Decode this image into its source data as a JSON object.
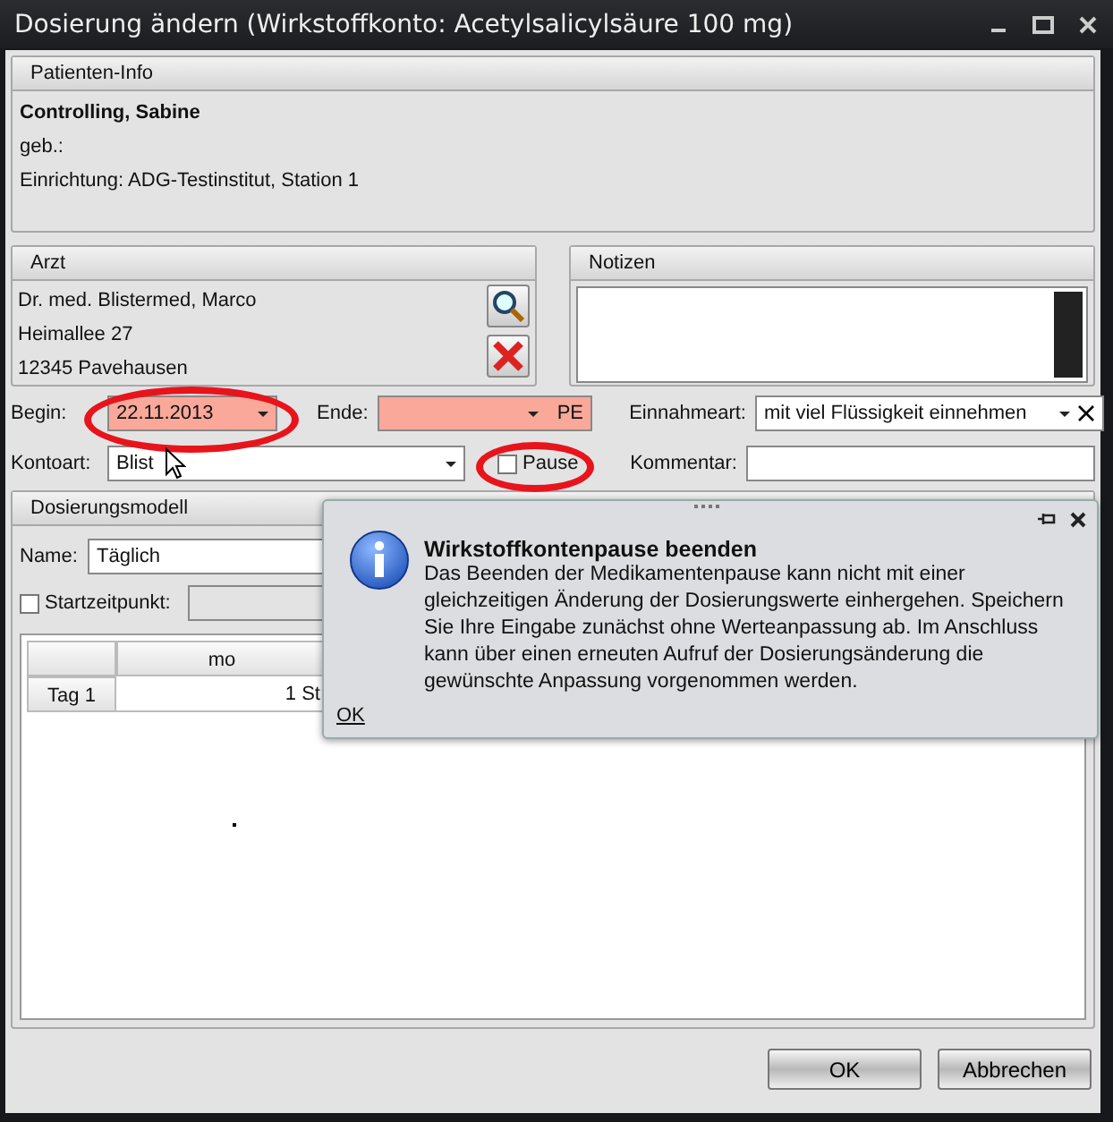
{
  "window": {
    "title": "Dosierung ändern (Wirkstoffkonto: Acetylsalicylsäure 100 mg)"
  },
  "patient_info": {
    "header": "Patienten-Info",
    "name": "Controlling, Sabine",
    "birth": "geb.:",
    "facility": "Einrichtung: ADG-Testinstitut, Station 1"
  },
  "doctor": {
    "header": "Arzt",
    "lines": [
      "Dr. med. Blistermed, Marco",
      "Heimallee 27",
      "12345  Pavehausen"
    ]
  },
  "notes": {
    "header": "Notizen"
  },
  "form": {
    "begin": {
      "label": "Begin:",
      "value": "22.11.2013"
    },
    "end": {
      "label": "Ende:",
      "suffix": "PE"
    },
    "intake": {
      "label": "Einnahmeart:",
      "value": "mit viel Flüssigkeit einnehmen"
    },
    "account_type": {
      "label": "Kontoart:",
      "value": "Blist"
    },
    "pause": {
      "label": "Pause",
      "checked": false
    },
    "comment": {
      "label": "Kommentar:"
    }
  },
  "dosing_model": {
    "header": "Dosierungsmodell",
    "name_label": "Name:",
    "name_value": "Täglich",
    "start": {
      "label": "Startzeitpunkt:",
      "checked": false
    },
    "table": {
      "columns": [
        "mo"
      ],
      "rows": [
        {
          "label": "Tag 1",
          "cells": [
            "1 St"
          ]
        }
      ]
    }
  },
  "popup": {
    "title": "Wirkstoffkontenpause beenden",
    "message": "Das Beenden der Medikamentenpause kann nicht mit einer gleichzeitigen Änderung der Dosierungswerte einhergehen. Speichern Sie Ihre Eingabe zunächst ohne Werteanpassung ab. Im Anschluss kann über einen erneuten Aufruf der Dosierungsänderung die gewünschte Anpassung vorgenommen werden.",
    "link": "OK"
  },
  "buttons": [
    {
      "label": "OK"
    },
    {
      "label": "Abbrechen"
    }
  ]
}
